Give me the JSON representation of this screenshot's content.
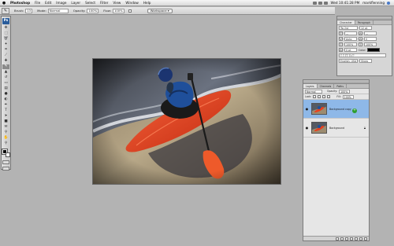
{
  "menubar": {
    "apple_icon": "",
    "app_name": "Photoshop",
    "items": [
      "File",
      "Edit",
      "Image",
      "Layer",
      "Select",
      "Filter",
      "View",
      "Window",
      "Help"
    ],
    "clock": "Wed 10:41:28 PM",
    "user": "markflenning"
  },
  "options_bar": {
    "tool_preset_icon": "brush-icon",
    "brush_label": "Brush:",
    "brush_size": "13",
    "mode_label": "Mode:",
    "mode_value": "Normal",
    "opacity_label": "Opacity:",
    "opacity_value": "100%",
    "flow_label": "Flow:",
    "flow_value": "100%",
    "workspace_label": "Workspace ▾"
  },
  "toolbox": {
    "logo": "Ps",
    "tools": [
      {
        "name": "move-tool-icon",
        "glyph": "✥"
      },
      {
        "name": "marquee-tool-icon",
        "glyph": "⬚"
      },
      {
        "name": "lasso-tool-icon",
        "glyph": "➰"
      },
      {
        "name": "magic-wand-tool-icon",
        "glyph": "✦"
      },
      {
        "name": "crop-tool-icon",
        "glyph": "⌗"
      },
      {
        "name": "slice-tool-icon",
        "glyph": "⟋"
      },
      {
        "name": "healing-brush-tool-icon",
        "glyph": "✚"
      },
      {
        "name": "brush-tool-icon",
        "glyph": "✎",
        "active": true
      },
      {
        "name": "clone-stamp-tool-icon",
        "glyph": "▲"
      },
      {
        "name": "history-brush-tool-icon",
        "glyph": "↺"
      },
      {
        "name": "eraser-tool-icon",
        "glyph": "▭"
      },
      {
        "name": "gradient-tool-icon",
        "glyph": "▤"
      },
      {
        "name": "blur-tool-icon",
        "glyph": "●"
      },
      {
        "name": "dodge-tool-icon",
        "glyph": "◐"
      },
      {
        "name": "pen-tool-icon",
        "glyph": "✒"
      },
      {
        "name": "type-tool-icon",
        "glyph": "T"
      },
      {
        "name": "path-selection-tool-icon",
        "glyph": "➤"
      },
      {
        "name": "shape-tool-icon",
        "glyph": "■"
      },
      {
        "name": "notes-tool-icon",
        "glyph": "✉"
      },
      {
        "name": "eyedropper-tool-icon",
        "glyph": "⚲"
      },
      {
        "name": "hand-tool-icon",
        "glyph": "✋"
      },
      {
        "name": "zoom-tool-icon",
        "glyph": "⚲"
      }
    ]
  },
  "nav_palette": {
    "tabs": [
      "Navigator",
      "Info",
      "Histogram"
    ],
    "rows": [
      [
        "Tw 2st",
        "12 pt"
      ],
      [
        "—",
        "—"
      ],
      [
        "Auto",
        "0"
      ],
      [
        "100%",
        "100%"
      ],
      [
        "0 pt",
        "Color:"
      ],
      [
        "T T TT Tt T'",
        ""
      ],
      [
        "English: USA",
        "Sharp"
      ]
    ],
    "footer_tabs": [
      "Character",
      "Paragraph"
    ]
  },
  "layers_palette": {
    "tabs": [
      "Layers",
      "Channels",
      "Paths"
    ],
    "blend_mode": "Normal",
    "opacity_label": "Opacity:",
    "opacity_value": "100%",
    "lock_label": "Lock:",
    "fill_label": "Fill:",
    "fill_value": "100%",
    "layers": [
      {
        "name": "Background copy",
        "selected": true,
        "eye_icon": "eye-icon"
      },
      {
        "name": "Background",
        "selected": false,
        "eye_icon": "eye-icon",
        "locked": true
      }
    ]
  },
  "colors": {
    "accent_selected_layer": "#8eb8e8",
    "kayak": "#e8401c"
  }
}
